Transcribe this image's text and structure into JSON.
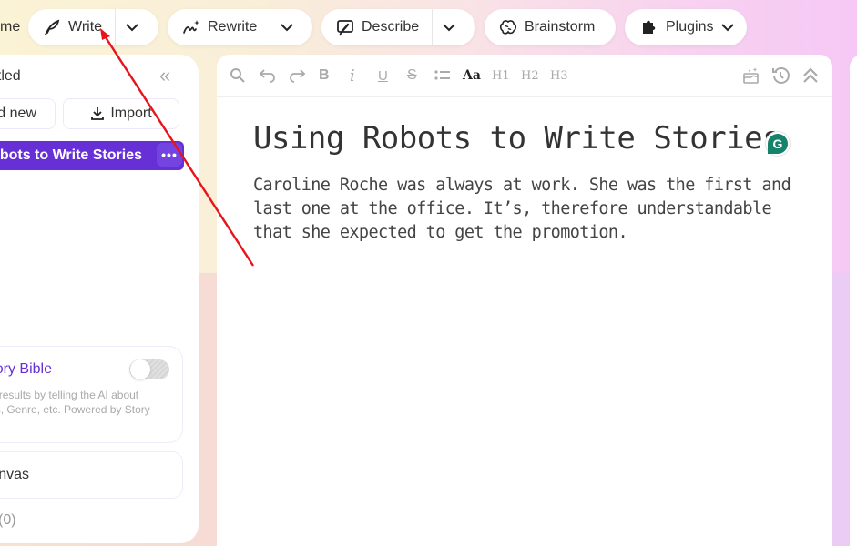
{
  "topbar": {
    "home_label": "me",
    "buttons": [
      {
        "label": "Write",
        "icon": "feather-pen-icon",
        "has_dropdown": true
      },
      {
        "label": "Rewrite",
        "icon": "sparkle-scribble-icon",
        "has_dropdown": true
      },
      {
        "label": "Describe",
        "icon": "speech-brush-icon",
        "has_dropdown": true
      },
      {
        "label": "Brainstorm",
        "icon": "brain-icon",
        "has_dropdown": false
      },
      {
        "label": "Plugins",
        "icon": "puzzle-piece-icon",
        "has_dropdown": true
      }
    ]
  },
  "sidebar": {
    "title": "ntitled",
    "add_new_label": "Add new",
    "import_label": "Import",
    "active_document": "Using Robots to Write Stories",
    "story_bible": {
      "title": "Story Bible",
      "description": "Get better results by telling the AI about Characters, Genre, etc. Powered by Story Engine.",
      "enabled": false
    },
    "canvas_label": "Canvas",
    "count_label": "(0)"
  },
  "editor": {
    "toolbar": {
      "format_aa": "Aa",
      "h1": "H1",
      "h2": "H2",
      "h3": "H3"
    },
    "title": "Using Robots to Write Stories",
    "body": "Caroline Roche was always at work. She was the first and last one at the office. It’s, therefore understandable that she expected to get the promotion.",
    "grammarly_letter": "G"
  },
  "colors": {
    "accent": "#6630d6",
    "annotation_arrow": "#e8141b",
    "grammarly": "#15836c"
  }
}
